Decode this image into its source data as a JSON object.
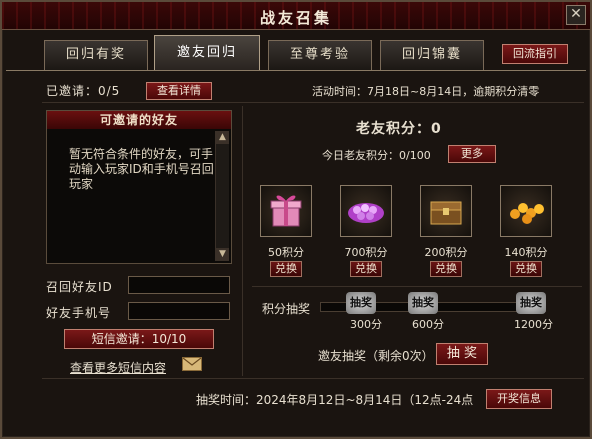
{
  "window": {
    "title": "战友召集",
    "close_label": "✕"
  },
  "tabs": [
    {
      "label": "回归有奖"
    },
    {
      "label": "邀友回归"
    },
    {
      "label": "至尊考验"
    },
    {
      "label": "回归锦囊"
    }
  ],
  "guide_button": "回流指引",
  "invited": {
    "label": "已邀请：0/5",
    "details_button": "查看详情"
  },
  "activity_time": "活动时间：7月18日~8月14日，逾期积分清零",
  "friends_panel": {
    "title": "可邀请的好友",
    "empty_text": "暂无符合条件的好友，可手动输入玩家ID和手机号召回玩家"
  },
  "recall_id_label": "召回好友ID",
  "phone_label": "好友手机号",
  "sms_invite_button": "短信邀请：10/10",
  "more_sms_link": "查看更多短信内容",
  "points": {
    "title": "老友积分：0",
    "today": "今日老友积分：0/100",
    "more_button": "更多"
  },
  "rewards": [
    {
      "icon": "gift-box-icon",
      "cost": "50积分",
      "button": "兑换"
    },
    {
      "icon": "purple-pearls-icon",
      "cost": "700积分",
      "button": "兑换"
    },
    {
      "icon": "treasure-chest-icon",
      "cost": "200积分",
      "button": "兑换"
    },
    {
      "icon": "gold-coins-icon",
      "cost": "140积分",
      "button": "兑换"
    }
  ],
  "lottery": {
    "label": "积分抽奖",
    "markers": [
      {
        "text": "抽奖",
        "score": "300分"
      },
      {
        "text": "抽奖",
        "score": "600分"
      },
      {
        "text": "抽奖",
        "score": "1200分"
      }
    ]
  },
  "invite_lottery": {
    "label": "邀友抽奖（剩余0次）",
    "button": "抽 奖"
  },
  "draw_time": "抽奖时间：2024年8月12日~8月14日（12点-24点",
  "prize_info_button": "开奖信息"
}
